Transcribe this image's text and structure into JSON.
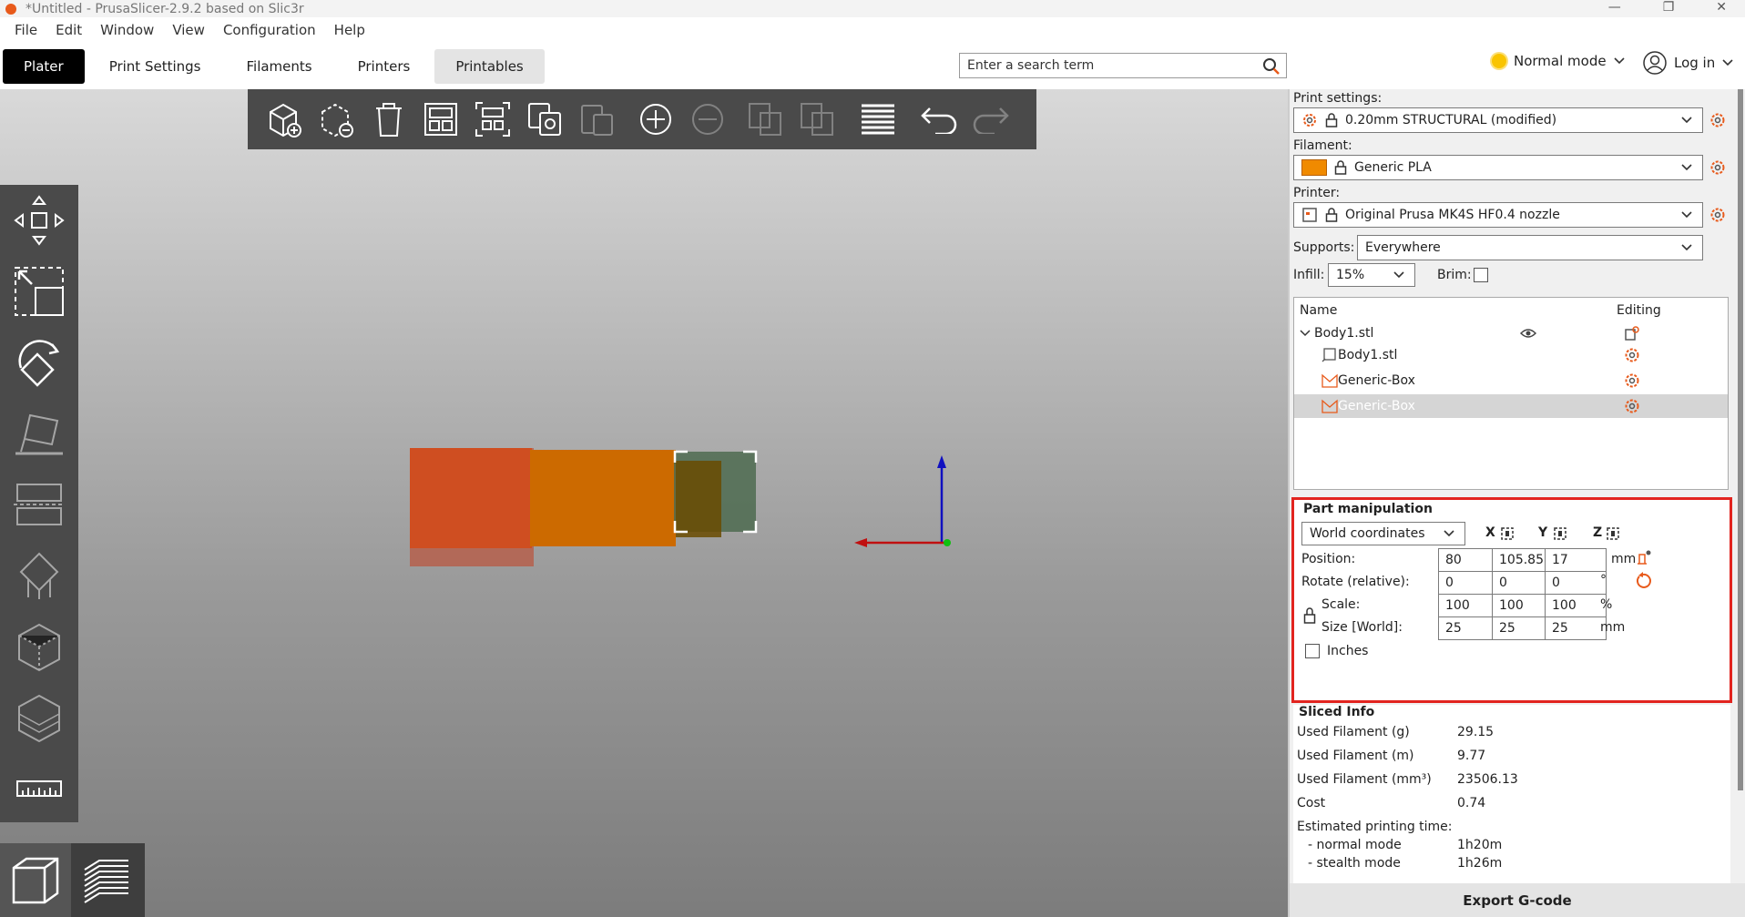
{
  "window": {
    "title": "*Untitled - PrusaSlicer-2.9.2 based on Slic3r"
  },
  "menu": [
    "File",
    "Edit",
    "Window",
    "View",
    "Configuration",
    "Help"
  ],
  "tabs": [
    {
      "label": "Plater"
    },
    {
      "label": "Print Settings"
    },
    {
      "label": "Filaments"
    },
    {
      "label": "Printers"
    },
    {
      "label": "Printables"
    }
  ],
  "search": {
    "placeholder": "Enter a search term"
  },
  "mode": {
    "label": "Normal mode"
  },
  "login": {
    "label": "Log in"
  },
  "colors": {
    "accent": "#e85a1b",
    "highlight": "#e2241f",
    "mode_dot": "#f9c400",
    "filament": "#f08a00"
  },
  "right": {
    "print_settings_label": "Print settings:",
    "print_settings_value": "0.20mm STRUCTURAL (modified)",
    "filament_label": "Filament:",
    "filament_value": "Generic PLA",
    "printer_label": "Printer:",
    "printer_value": "Original Prusa MK4S HF0.4 nozzle",
    "supports_label": "Supports:",
    "supports_value": "Everywhere",
    "infill_label": "Infill:",
    "infill_value": "15%",
    "brim_label": "Brim:"
  },
  "objects": {
    "col_name": "Name",
    "col_editing": "Editing",
    "rows": [
      {
        "name": "Body1.stl"
      },
      {
        "name": "Body1.stl"
      },
      {
        "name": "Generic-Box"
      },
      {
        "name": "Generic-Box"
      }
    ]
  },
  "part": {
    "title": "Part manipulation",
    "coord_system": "World coordinates",
    "axes": [
      "X",
      "Y",
      "Z"
    ],
    "position_label": "Position:",
    "position": [
      "80",
      "105.85",
      "17"
    ],
    "position_unit": "mm",
    "rotate_label": "Rotate (relative):",
    "rotate": [
      "0",
      "0",
      "0"
    ],
    "rotate_unit": "°",
    "scale_label": "Scale:",
    "scale": [
      "100",
      "100",
      "100"
    ],
    "scale_unit": "%",
    "size_label": "Size [World]:",
    "size": [
      "25",
      "25",
      "25"
    ],
    "size_unit": "mm",
    "inches_label": "Inches"
  },
  "sliced": {
    "title": "Sliced Info",
    "rows": [
      {
        "label": "Used Filament (g)",
        "value": "29.15"
      },
      {
        "label": "Used Filament (m)",
        "value": "9.77"
      },
      {
        "label": "Used Filament (mm³)",
        "value": "23506.13"
      },
      {
        "label": "Cost",
        "value": "0.74"
      }
    ],
    "time_label": "Estimated printing time:",
    "normal_label": "- normal mode",
    "normal_value": "1h20m",
    "stealth_label": "- stealth mode",
    "stealth_value": "1h26m"
  },
  "export_label": "Export G-code"
}
